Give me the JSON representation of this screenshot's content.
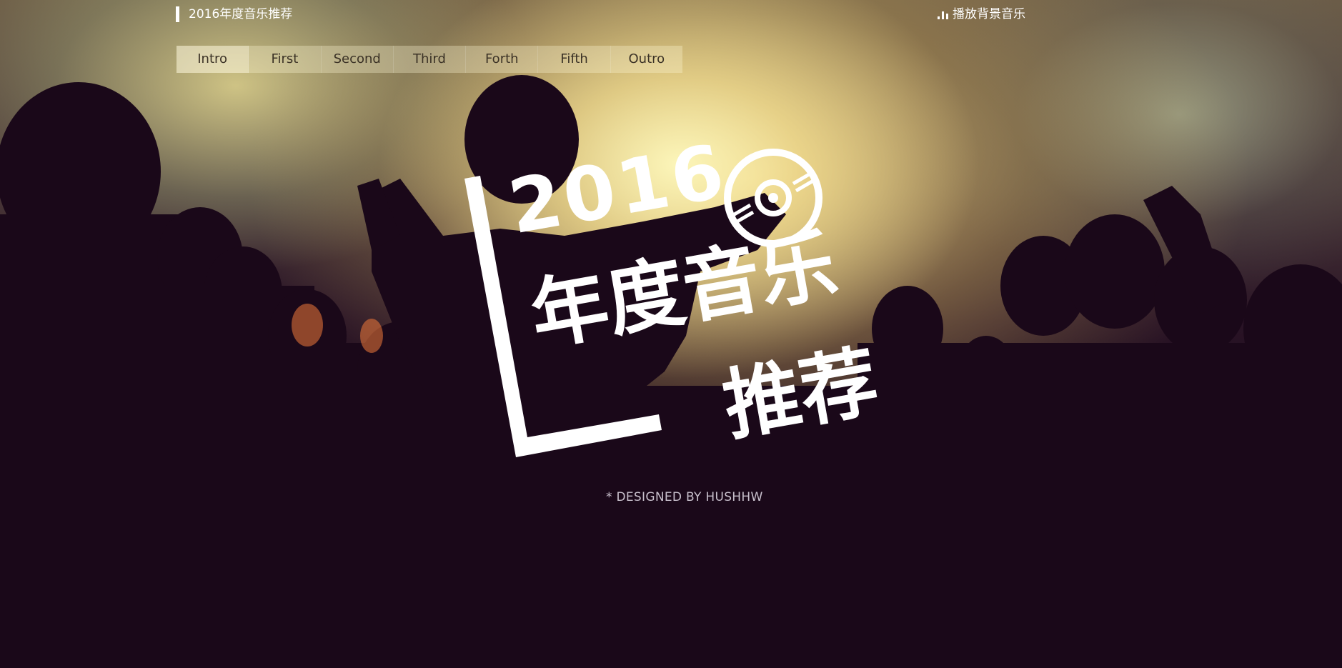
{
  "header": {
    "brand_title": "2016年度音乐推荐",
    "music_toggle_label": "播放背景音乐",
    "music_icon": "equalizer-icon"
  },
  "nav": {
    "items": [
      {
        "label": "Intro"
      },
      {
        "label": "First"
      },
      {
        "label": "Second"
      },
      {
        "label": "Third"
      },
      {
        "label": "Forth"
      },
      {
        "label": "Fifth"
      },
      {
        "label": "Outro"
      }
    ]
  },
  "hero": {
    "year": "2016",
    "line1": "年度音乐",
    "line2": "推荐",
    "disc_icon": "cd-disc-icon"
  },
  "footer": {
    "designer": "* DESIGNED BY HUSHHW"
  },
  "colors": {
    "text_light": "#ffffff",
    "nav_text": "#3b3226",
    "designer_text": "#c8c0cc"
  }
}
